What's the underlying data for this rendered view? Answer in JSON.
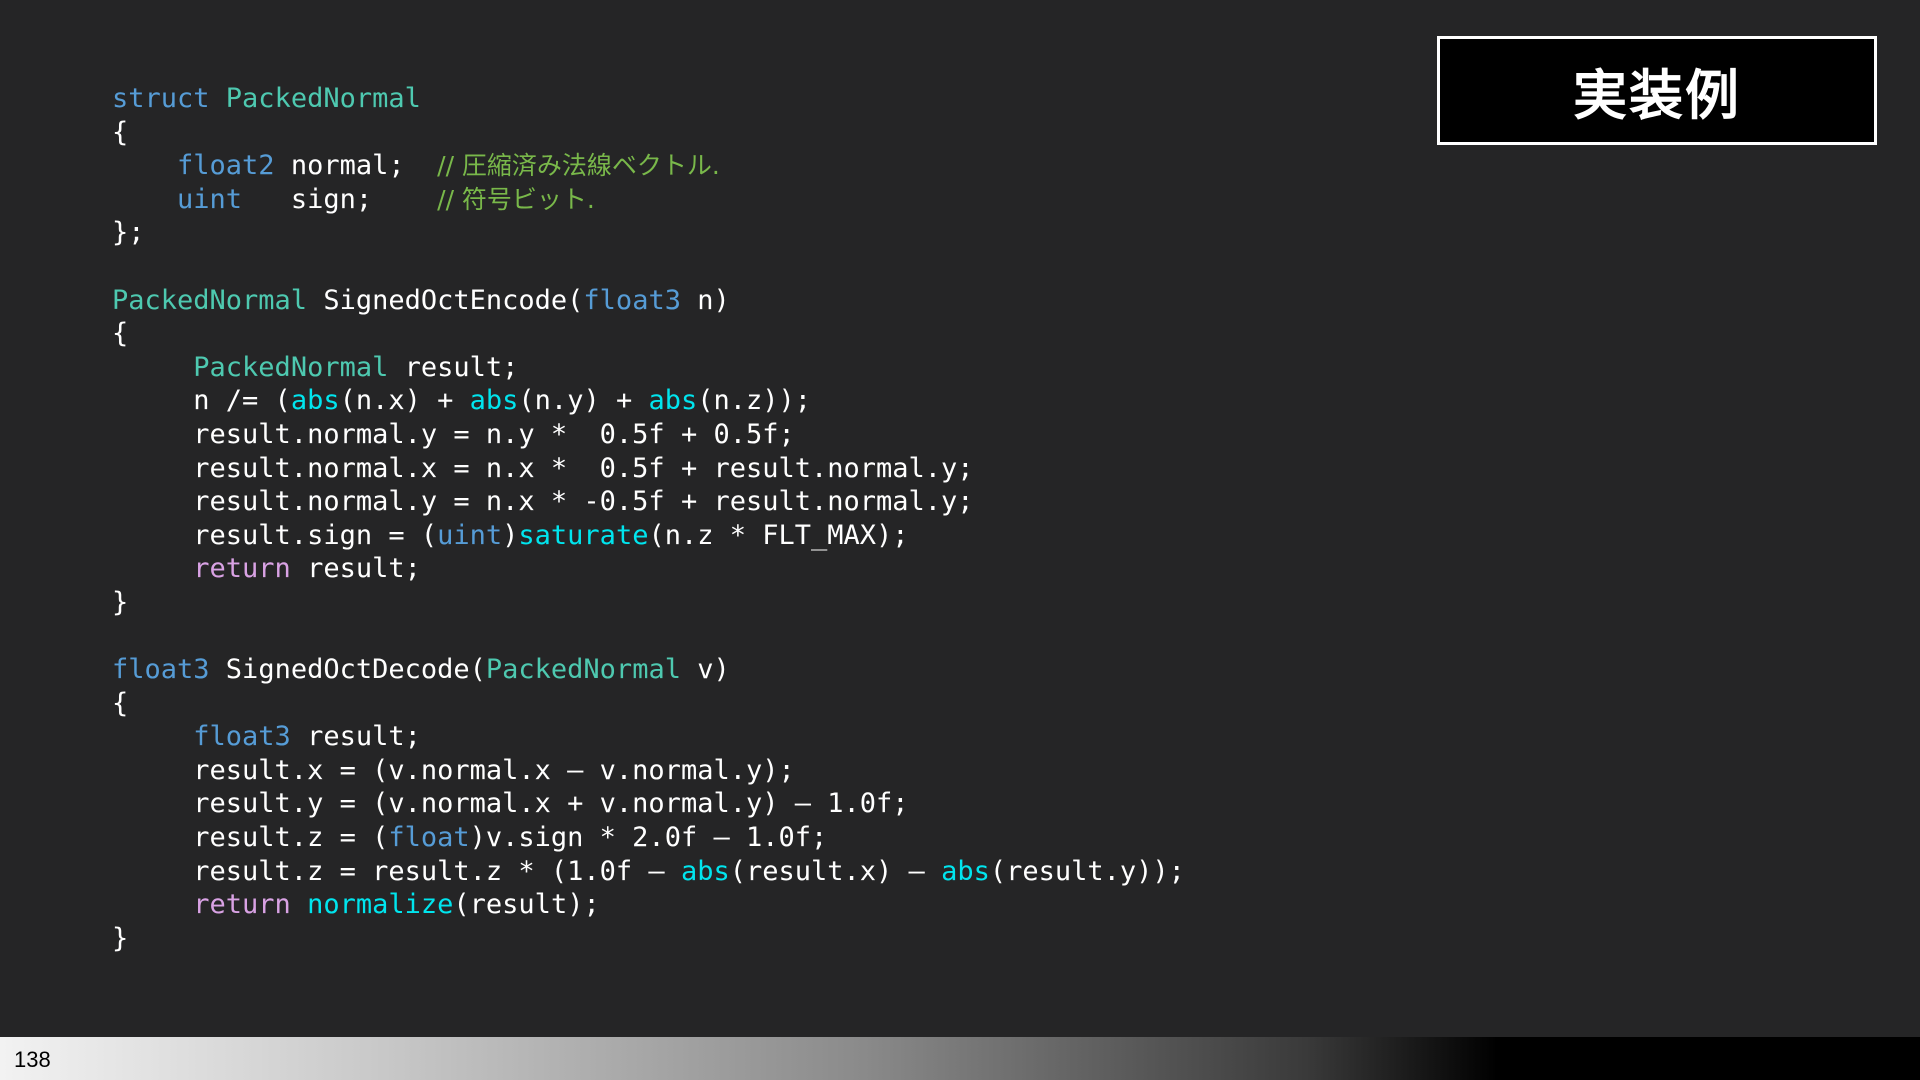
{
  "slide": {
    "title": "実装例",
    "page_number": "138"
  },
  "code": {
    "lines": [
      [
        [
          "kw",
          "struct "
        ],
        [
          "ty",
          "PackedNormal"
        ]
      ],
      [
        [
          "pl",
          "{"
        ]
      ],
      [
        [
          "pl",
          "    "
        ],
        [
          "kw",
          "float2"
        ],
        [
          "pl",
          " normal;  "
        ],
        [
          "cm",
          "// 圧縮済み法線ベクトル."
        ]
      ],
      [
        [
          "pl",
          "    "
        ],
        [
          "kw",
          "uint"
        ],
        [
          "pl",
          "   sign;    "
        ],
        [
          "cm",
          "// 符号ビット."
        ]
      ],
      [
        [
          "pl",
          "};"
        ]
      ],
      [],
      [
        [
          "ty",
          "PackedNormal"
        ],
        [
          "pl",
          " SignedOctEncode("
        ],
        [
          "kw",
          "float3"
        ],
        [
          "pl",
          " n)"
        ]
      ],
      [
        [
          "pl",
          "{"
        ]
      ],
      [
        [
          "pl",
          "     "
        ],
        [
          "ty",
          "PackedNormal"
        ],
        [
          "pl",
          " result;"
        ]
      ],
      [
        [
          "pl",
          "     n /= ("
        ],
        [
          "fn",
          "abs"
        ],
        [
          "pl",
          "(n.x) + "
        ],
        [
          "fn",
          "abs"
        ],
        [
          "pl",
          "(n.y) + "
        ],
        [
          "fn",
          "abs"
        ],
        [
          "pl",
          "(n.z));"
        ]
      ],
      [
        [
          "pl",
          "     result.normal.y = n.y *  0.5f + 0.5f;"
        ]
      ],
      [
        [
          "pl",
          "     result.normal.x = n.x *  0.5f + result.normal.y;"
        ]
      ],
      [
        [
          "pl",
          "     result.normal.y = n.x * -0.5f + result.normal.y;"
        ]
      ],
      [
        [
          "pl",
          "     result.sign = ("
        ],
        [
          "kw",
          "uint"
        ],
        [
          "pl",
          ")"
        ],
        [
          "fn",
          "saturate"
        ],
        [
          "pl",
          "(n.z * FLT_MAX);"
        ]
      ],
      [
        [
          "pl",
          "     "
        ],
        [
          "ret",
          "return"
        ],
        [
          "pl",
          " result;"
        ]
      ],
      [
        [
          "pl",
          "}"
        ]
      ],
      [],
      [
        [
          "kw",
          "float3"
        ],
        [
          "pl",
          " SignedOctDecode("
        ],
        [
          "ty",
          "PackedNormal"
        ],
        [
          "pl",
          " v)"
        ]
      ],
      [
        [
          "pl",
          "{"
        ]
      ],
      [
        [
          "pl",
          "     "
        ],
        [
          "kw",
          "float3"
        ],
        [
          "pl",
          " result;"
        ]
      ],
      [
        [
          "pl",
          "     result.x = (v.normal.x – v.normal.y);"
        ]
      ],
      [
        [
          "pl",
          "     result.y = (v.normal.x + v.normal.y) – 1.0f;"
        ]
      ],
      [
        [
          "pl",
          "     result.z = ("
        ],
        [
          "kw",
          "float"
        ],
        [
          "pl",
          ")v.sign * 2.0f – 1.0f;"
        ]
      ],
      [
        [
          "pl",
          "     result.z = result.z * (1.0f – "
        ],
        [
          "fn",
          "abs"
        ],
        [
          "pl",
          "(result.x) – "
        ],
        [
          "fn",
          "abs"
        ],
        [
          "pl",
          "(result.y));"
        ]
      ],
      [
        [
          "pl",
          "     "
        ],
        [
          "ret",
          "return"
        ],
        [
          "pl",
          " "
        ],
        [
          "fn",
          "normalize"
        ],
        [
          "pl",
          "(result);"
        ]
      ],
      [
        [
          "pl",
          "}"
        ]
      ]
    ]
  },
  "colors": {
    "background": "#252526",
    "keyword": "#569cd6",
    "type": "#4ec9b0",
    "function": "#00e5ee",
    "return": "#d9a2e4",
    "comment": "#79b84a",
    "plain": "#ffffff"
  }
}
